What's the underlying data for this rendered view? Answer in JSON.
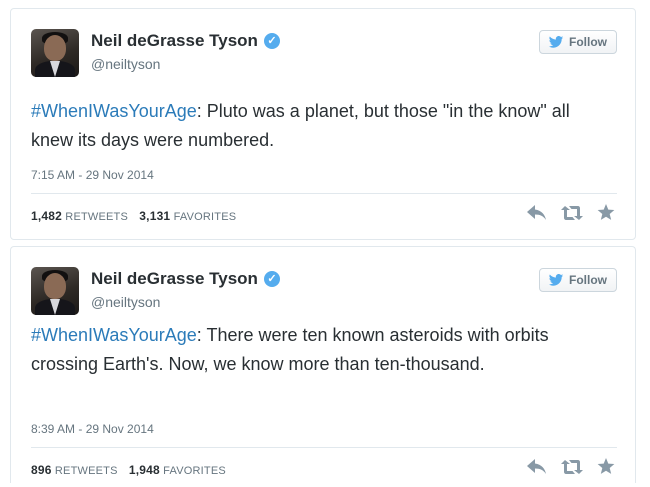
{
  "tweets": [
    {
      "name": "Neil deGrasse Tyson",
      "handle": "@neiltyson",
      "follow_label": "Follow",
      "hashtag": "#WhenIWasYourAge",
      "text": ": Pluto was a planet, but those \"in the know\" all knew its days were numbered.",
      "time": "7:15 AM - 29 Nov 2014",
      "retweets": "1,482",
      "retweets_label": "Retweets",
      "favorites": "3,131",
      "favorites_label": "Favorites"
    },
    {
      "name": "Neil deGrasse Tyson",
      "handle": "@neiltyson",
      "follow_label": "Follow",
      "hashtag": "#WhenIWasYourAge",
      "text": ": There were ten known asteroids with orbits crossing Earth's. Now, we know more than ten-thousand.",
      "time": "8:39 AM - 29 Nov 2014",
      "retweets": "896",
      "retweets_label": "Retweets",
      "favorites": "1,948",
      "favorites_label": "Favorites"
    }
  ],
  "icons": {
    "verified": "verified-badge-icon",
    "follow": "twitter-bird-icon",
    "reply": "reply-icon",
    "retweet": "retweet-icon",
    "favorite": "star-icon"
  },
  "colors": {
    "link": "#2b7bb9",
    "verified": "#55acee",
    "muted": "#66757f",
    "action_icons": "#8899a6"
  }
}
